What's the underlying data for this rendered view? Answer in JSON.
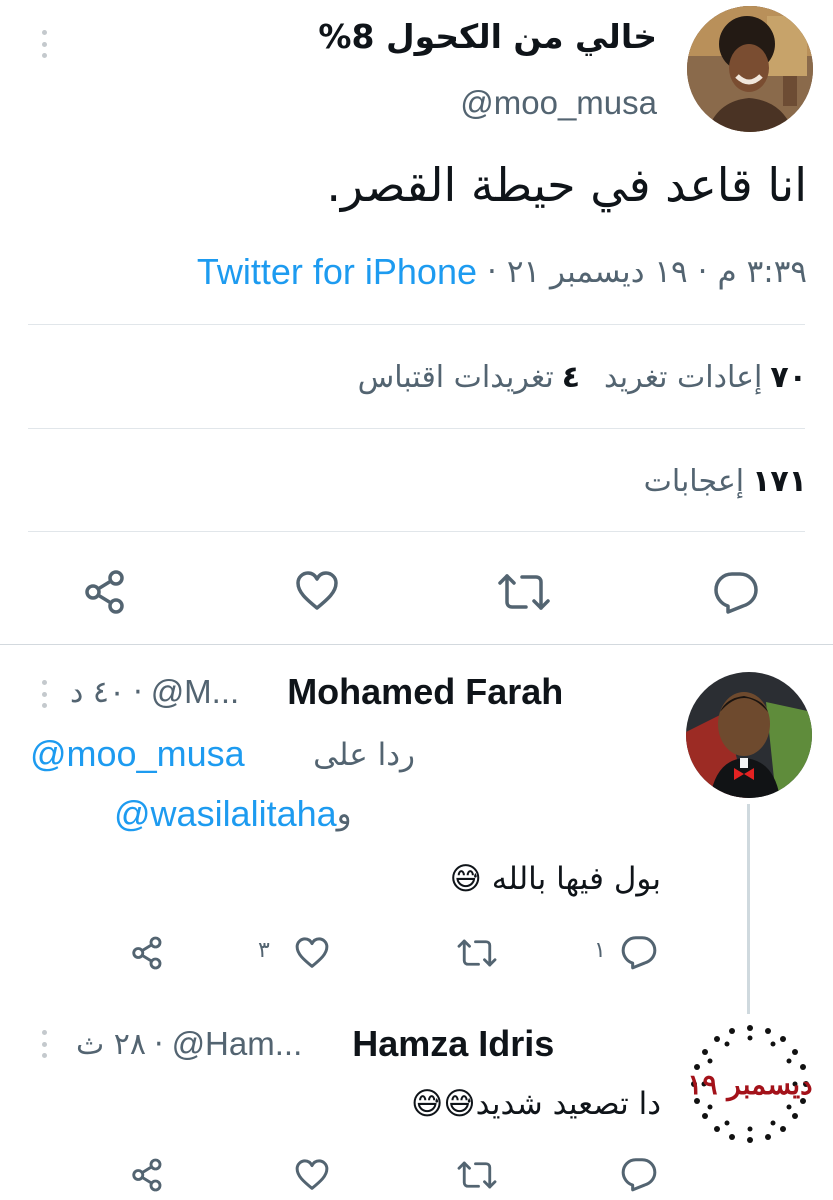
{
  "main_tweet": {
    "display_name": "خالي من الكحول 8%",
    "handle": "@moo_musa",
    "text": "انا قاعد في حيطة القصر.",
    "time": "٣:٣٩ م",
    "date": "١٩ ديسمبر ٢١",
    "separator": "·",
    "source": "Twitter for iPhone",
    "retweets_count": "٧٠",
    "retweets_label": "إعادات تغريد",
    "quotes_count": "٤",
    "quotes_label": "تغريدات اقتباس",
    "likes_count": "١٧١",
    "likes_label": "إعجابات"
  },
  "replies": [
    {
      "display_name": "Mohamed Farah",
      "handle": "@M...",
      "time": "٤٠ د",
      "reply_to_prefix": "ردا على",
      "reply_to_1": "@moo_musa",
      "reply_to_conj": "و",
      "reply_to_2": "@wasilalitaha",
      "text": "بول فيها بالله 😅",
      "reply_count": "١",
      "like_count": "٣"
    },
    {
      "display_name": "Hamza Idris",
      "handle": "@Ham...",
      "time": "٢٨ ث",
      "text": "دا تصعيد شديد😅😅",
      "avatar_text": "ديسمبر ١٩"
    }
  ],
  "colors": {
    "accent": "#1d9bf0",
    "text": "#0f1419",
    "secondary": "#536471",
    "icon": "#536471",
    "divider": "#e1e6ea"
  }
}
